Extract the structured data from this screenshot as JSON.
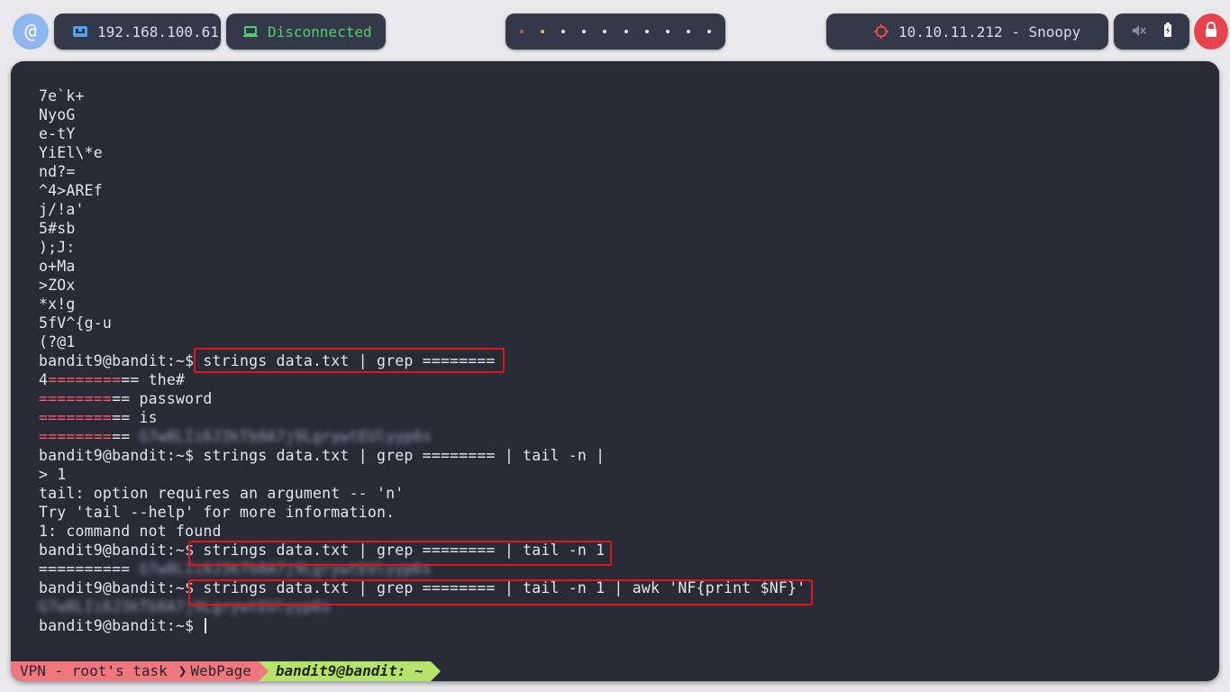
{
  "topbar": {
    "local_ip": "192.168.100.61",
    "vpn_status": "Disconnected",
    "target": "10.10.11.212 - Snoopy",
    "workspace_count": 10,
    "active_workspace": 1
  },
  "terminal": {
    "lines": [
      {
        "parts": [
          {
            "t": "7e`k+"
          }
        ]
      },
      {
        "parts": [
          {
            "t": "NyoG"
          }
        ]
      },
      {
        "parts": [
          {
            "t": "e-tY"
          }
        ]
      },
      {
        "parts": [
          {
            "t": "YiEl\\*e"
          }
        ]
      },
      {
        "parts": [
          {
            "t": "nd?="
          }
        ]
      },
      {
        "parts": [
          {
            "t": "^4>AREf"
          }
        ]
      },
      {
        "parts": [
          {
            "t": "j/!a'"
          }
        ]
      },
      {
        "parts": [
          {
            "t": "5#sb"
          }
        ]
      },
      {
        "parts": [
          {
            "t": ");J:"
          }
        ]
      },
      {
        "parts": [
          {
            "t": "o+Ma"
          }
        ]
      },
      {
        "parts": [
          {
            "t": ">ZOx"
          }
        ]
      },
      {
        "parts": [
          {
            "t": "*x!g"
          }
        ]
      },
      {
        "parts": [
          {
            "t": "5fV^{g-u"
          }
        ]
      },
      {
        "parts": [
          {
            "t": "(?@1"
          }
        ]
      },
      {
        "parts": [
          {
            "t": "bandit9@bandit:~$ strings data.txt | grep ========"
          }
        ],
        "highlight": true
      },
      {
        "parts": [
          {
            "t": "4"
          },
          {
            "t": "========",
            "c": "red"
          },
          {
            "t": "== the#"
          }
        ]
      },
      {
        "parts": [
          {
            "t": "========",
            "c": "red"
          },
          {
            "t": "== password"
          }
        ]
      },
      {
        "parts": [
          {
            "t": "========",
            "c": "red"
          },
          {
            "t": "== is"
          }
        ]
      },
      {
        "parts": [
          {
            "t": "========",
            "c": "red"
          },
          {
            "t": "== "
          },
          {
            "t": "G7w8LIi6J3kTb8A7j9LgrywtEUlyyp6s",
            "c": "blur"
          }
        ]
      },
      {
        "parts": [
          {
            "t": "bandit9@bandit:~$ strings data.txt | grep ======== | tail -n |"
          }
        ]
      },
      {
        "parts": [
          {
            "t": "> 1"
          }
        ]
      },
      {
        "parts": [
          {
            "t": "tail: option requires an argument -- 'n'"
          }
        ]
      },
      {
        "parts": [
          {
            "t": "Try 'tail --help' for more information."
          }
        ]
      },
      {
        "parts": [
          {
            "t": "1: command not found"
          }
        ]
      },
      {
        "parts": [
          {
            "t": "bandit9@bandit:~$ strings data.txt | grep ======== | tail -n 1"
          }
        ],
        "highlight": true
      },
      {
        "parts": [
          {
            "t": "========== "
          },
          {
            "t": "G7w8LIi6J3kTb8A7j9LgrywtEUlyyp6s",
            "c": "blur"
          }
        ]
      },
      {
        "parts": [
          {
            "t": "bandit9@bandit:~$ strings data.txt | grep ======== | tail -n 1 | awk 'NF{print $NF}'"
          }
        ],
        "highlight": true
      },
      {
        "parts": [
          {
            "t": "G7w8LIi6J3kTb8A7j9LgrywtEUlyyp6s",
            "c": "blur"
          }
        ]
      },
      {
        "parts": [
          {
            "t": "bandit9@bandit:~$ "
          }
        ],
        "cursor": true
      }
    ]
  },
  "statusline": {
    "segment1": "VPN - root's task",
    "segment2": "WebPage",
    "segment3": "bandit9@bandit: ~"
  }
}
